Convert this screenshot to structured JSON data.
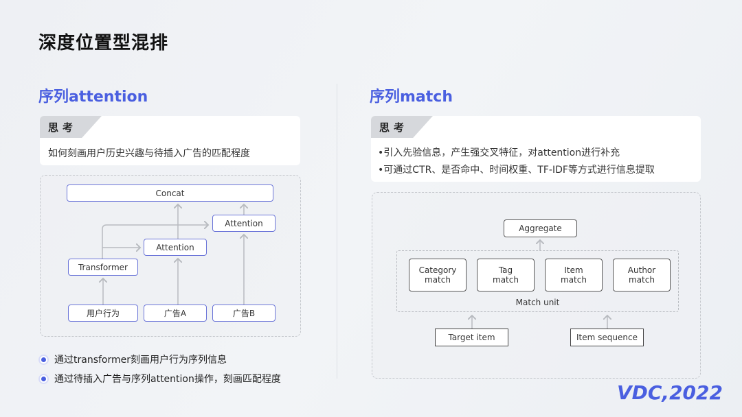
{
  "page_title": "深度位置型混排",
  "left": {
    "section_title": "序列attention",
    "think": {
      "tag": "思考",
      "lines": [
        "如何刻画用户历史兴趣与待插入广告的匹配程度"
      ]
    },
    "diagram": {
      "nodes": {
        "concat": "Concat",
        "attention_b": "Attention",
        "attention_a": "Attention",
        "transformer": "Transformer",
        "user_behavior": "用户行为",
        "ad_a": "广告A",
        "ad_b": "广告B"
      }
    },
    "bullets": [
      "通过transformer刻画用户行为序列信息",
      "通过待插入广告与序列attention操作，刻画匹配程度"
    ]
  },
  "right": {
    "section_title": "序列match",
    "think": {
      "tag": "思考",
      "lines": [
        "•引入先验信息，产生强交叉特征，对attention进行补充",
        "•可通过CTR、是否命中、时间权重、TF-IDF等方式进行信息提取"
      ]
    },
    "diagram": {
      "nodes": {
        "aggregate": "Aggregate",
        "category_match": [
          "Category",
          "match"
        ],
        "tag_match": [
          "Tag",
          "match"
        ],
        "item_match": [
          "Item",
          "match"
        ],
        "author_match": [
          "Author",
          "match"
        ],
        "match_unit": "Match unit",
        "target_item": "Target item",
        "item_sequence": "Item sequence"
      }
    }
  },
  "logo": "VDC,2022",
  "colors": {
    "accent": "#4a5fe0",
    "node_border": "#6a74d8",
    "arrow": "#b8bbc0"
  }
}
